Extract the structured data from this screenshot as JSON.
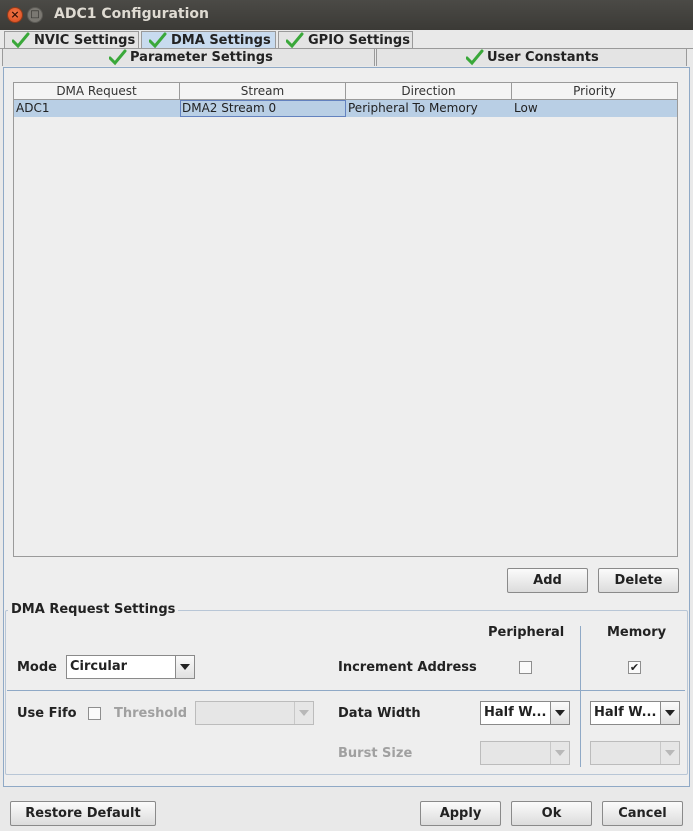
{
  "window": {
    "title": "ADC1 Configuration",
    "close_glyph": "×",
    "max_glyph": "□"
  },
  "tabs_row1": [
    {
      "label": "NVIC Settings",
      "icon": "check-icon"
    },
    {
      "label": "DMA Settings",
      "icon": "check-icon",
      "selected": true
    },
    {
      "label": "GPIO Settings",
      "icon": "check-icon"
    }
  ],
  "tabs_row2": [
    {
      "label": "Parameter Settings",
      "icon": "check-icon"
    },
    {
      "label": "User Constants",
      "icon": "check-icon"
    }
  ],
  "table": {
    "columns": [
      "DMA Request",
      "Stream",
      "Direction",
      "Priority"
    ],
    "rows": [
      [
        "ADC1",
        "DMA2 Stream 0",
        "Peripheral To Memory",
        "Low"
      ]
    ]
  },
  "actions": {
    "add": "Add",
    "delete": "Delete"
  },
  "dma_settings": {
    "group_title": "DMA Request Settings",
    "col_peripheral": "Peripheral",
    "col_memory": "Memory",
    "mode_label": "Mode",
    "mode_value": "Circular",
    "increment_label": "Increment Address",
    "peripheral_increment": false,
    "memory_increment": true,
    "use_fifo_label": "Use Fifo",
    "use_fifo": false,
    "threshold_label": "Threshold",
    "threshold_value": "",
    "data_width_label": "Data Width",
    "peripheral_data_width": "Half W...",
    "memory_data_width": "Half W...",
    "burst_size_label": "Burst Size",
    "peripheral_burst": "",
    "memory_burst": "",
    "checked_glyph": "✔"
  },
  "footer": {
    "restore": "Restore Default",
    "apply": "Apply",
    "ok": "Ok",
    "cancel": "Cancel"
  },
  "colors": {
    "selected_row": "#b9cfe5",
    "selected_tab": "#c8dbef",
    "check": "#3aa83a"
  }
}
